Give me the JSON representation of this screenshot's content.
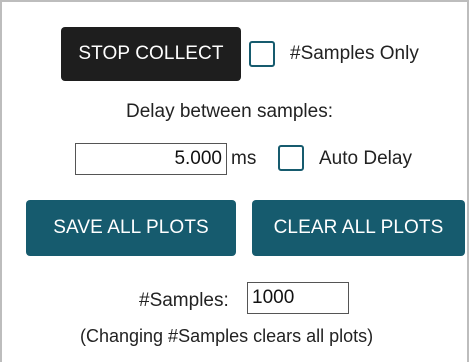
{
  "controls": {
    "stop_collect_label": "STOP COLLECT",
    "samples_only_label": "#Samples Only",
    "delay_label": "Delay between samples:",
    "delay_value": "5.000",
    "delay_unit": "ms",
    "auto_delay_label": "Auto Delay",
    "save_all_plots_label": "SAVE ALL PLOTS",
    "clear_all_plots_label": "CLEAR ALL PLOTS",
    "samples_label": "#Samples:",
    "samples_value": "1000",
    "samples_note": "(Changing #Samples clears all plots)"
  },
  "colors": {
    "primary_teal": "#165b6e",
    "dark_button": "#1e1e1e"
  }
}
